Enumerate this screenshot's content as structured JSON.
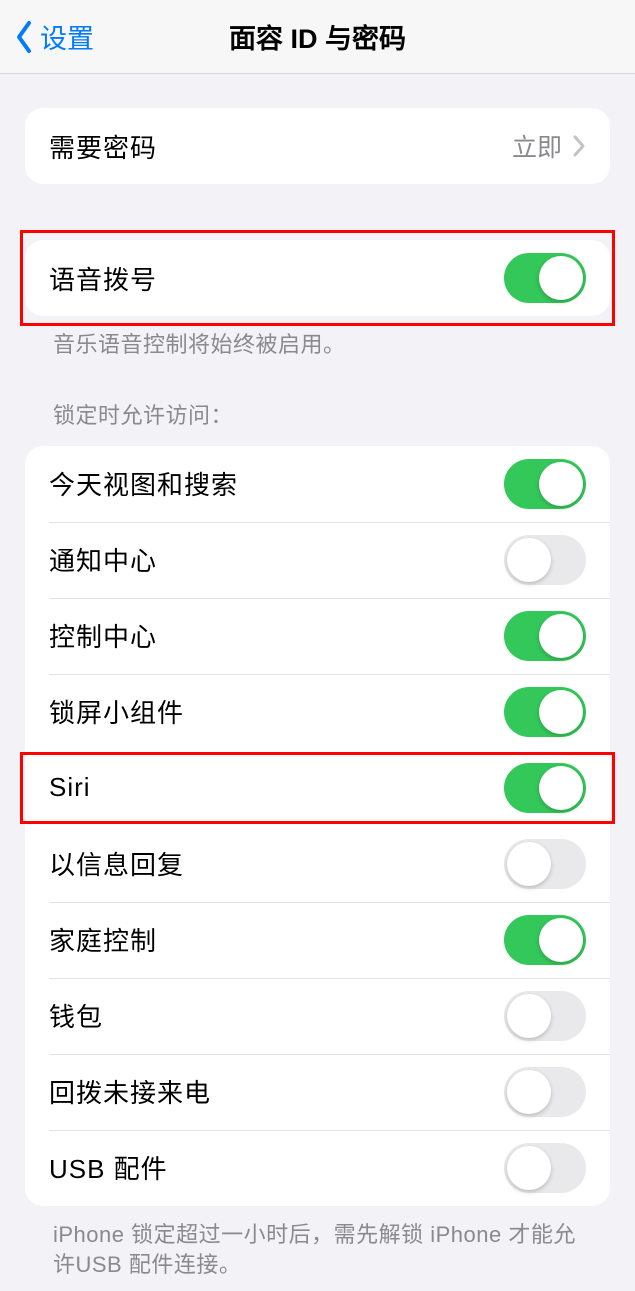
{
  "header": {
    "back_label": "设置",
    "title": "面容 ID 与密码"
  },
  "require_passcode": {
    "label": "需要密码",
    "value": "立即"
  },
  "voice_dial": {
    "label": "语音拨号",
    "enabled": true,
    "footer": "音乐语音控制将始终被启用。"
  },
  "locked_access": {
    "header": "锁定时允许访问：",
    "items": [
      {
        "label": "今天视图和搜索",
        "enabled": true
      },
      {
        "label": "通知中心",
        "enabled": false
      },
      {
        "label": "控制中心",
        "enabled": true
      },
      {
        "label": "锁屏小组件",
        "enabled": true
      },
      {
        "label": "Siri",
        "enabled": true
      },
      {
        "label": "以信息回复",
        "enabled": false
      },
      {
        "label": "家庭控制",
        "enabled": true
      },
      {
        "label": "钱包",
        "enabled": false
      },
      {
        "label": "回拨未接来电",
        "enabled": false
      },
      {
        "label": "USB 配件",
        "enabled": false
      }
    ],
    "footer": "iPhone 锁定超过一小时后，需先解锁 iPhone 才能允许USB 配件连接。"
  }
}
